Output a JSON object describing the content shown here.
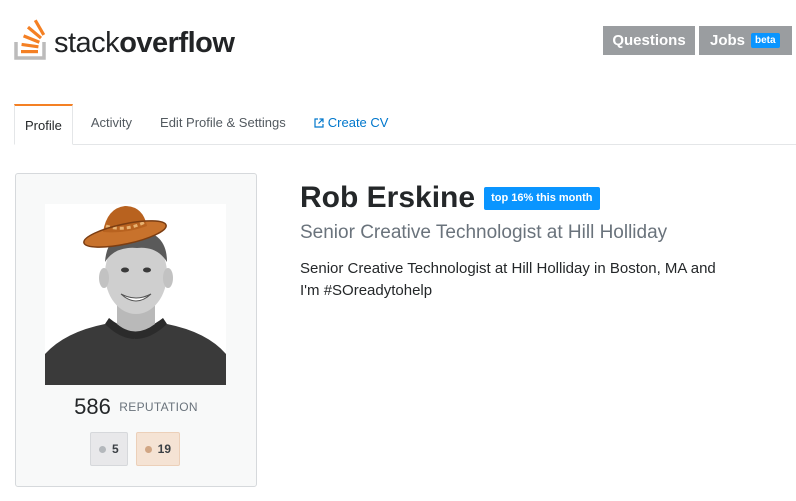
{
  "brand": {
    "name_light": "stack",
    "name_bold": "overflow",
    "accent": "#f48024"
  },
  "topnav": {
    "questions_label": "Questions",
    "jobs_label": "Jobs",
    "jobs_badge": "beta"
  },
  "tabs": [
    {
      "label": "Profile",
      "active": true
    },
    {
      "label": "Activity"
    },
    {
      "label": "Edit Profile & Settings"
    },
    {
      "label": "Create CV",
      "icon": "external-link-icon"
    }
  ],
  "profile": {
    "name": "Rob Erskine",
    "rank_badge": "top 16% this month",
    "title": "Senior Creative Technologist at Hill Holliday",
    "bio_line1": "Senior Creative Technologist at Hill Holliday in Boston, MA and",
    "bio_line2": "I'm #SOreadytohelp",
    "reputation": "586",
    "reputation_label": "REPUTATION",
    "badges": {
      "silver": "5",
      "bronze": "19"
    }
  },
  "colors": {
    "link": "#0077cc",
    "rank_blue": "#0a95ff",
    "nav_gray": "#9a9da0"
  }
}
